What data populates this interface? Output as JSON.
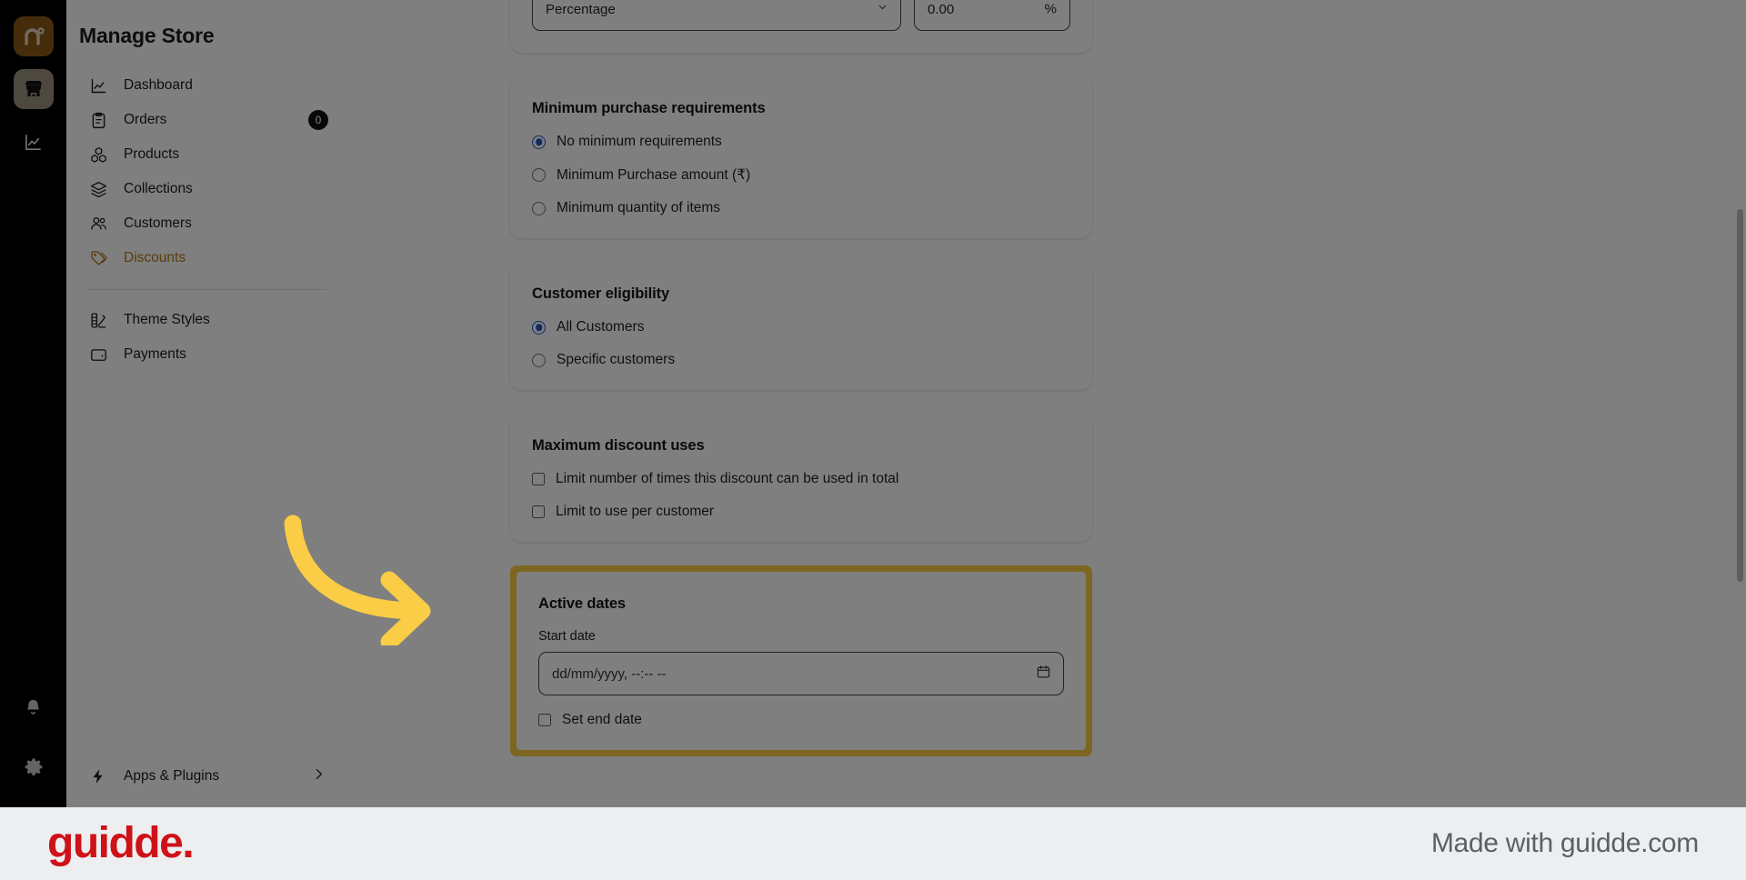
{
  "rail": {
    "logo_icon": "nuvemshop-n-logo-icon",
    "items": [
      {
        "name": "store-icon",
        "active": true
      },
      {
        "name": "analytics-icon",
        "active": false
      }
    ],
    "bottom": [
      {
        "name": "bell-icon"
      },
      {
        "name": "gear-icon"
      }
    ]
  },
  "sidebar": {
    "title": "Manage Store",
    "items": [
      {
        "label": "Dashboard",
        "icon": "chart-line-icon",
        "active": false,
        "badge": null
      },
      {
        "label": "Orders",
        "icon": "clipboard-icon",
        "active": false,
        "badge": "0"
      },
      {
        "label": "Products",
        "icon": "boxes-icon",
        "active": false,
        "badge": null
      },
      {
        "label": "Collections",
        "icon": "layers-icon",
        "active": false,
        "badge": null
      },
      {
        "label": "Customers",
        "icon": "users-icon",
        "active": false,
        "badge": null
      },
      {
        "label": "Discounts",
        "icon": "tags-icon",
        "active": true,
        "badge": null
      }
    ],
    "items2": [
      {
        "label": "Theme Styles",
        "icon": "palette-icon",
        "active": false
      },
      {
        "label": "Payments",
        "icon": "wallet-icon",
        "active": false
      }
    ],
    "apps": {
      "label": "Apps & Plugins",
      "icon": "bolt-icon",
      "chevron": "chevron-right-icon"
    }
  },
  "main": {
    "discount_value_card": {
      "type_value": "Percentage",
      "amount_value": "0.00",
      "amount_suffix": "%"
    },
    "minimum_purchase": {
      "title": "Minimum purchase requirements",
      "options": [
        {
          "label": "No minimum requirements",
          "checked": true
        },
        {
          "label": "Minimum Purchase amount (₹)",
          "checked": false
        },
        {
          "label": "Minimum quantity of items",
          "checked": false
        }
      ]
    },
    "customer_eligibility": {
      "title": "Customer eligibility",
      "options": [
        {
          "label": "All Customers",
          "checked": true
        },
        {
          "label": "Specific customers",
          "checked": false
        }
      ]
    },
    "maximum_uses": {
      "title": "Maximum discount uses",
      "options": [
        {
          "label": "Limit number of times this discount can be used in total",
          "checked": false
        },
        {
          "label": "Limit to use per customer",
          "checked": false
        }
      ]
    },
    "active_dates": {
      "title": "Active dates",
      "start_date_label": "Start date",
      "start_date_placeholder": "dd/mm/yyyy, --:-- --",
      "calendar_icon": "calendar-icon",
      "end_date_checkbox_label": "Set end date",
      "highlight_color": "#fbcc45"
    }
  },
  "annotation": {
    "arrow_icon": "curved-arrow-right-icon",
    "arrow_color": "#fbcc45"
  },
  "footer": {
    "logo_text": "guidde.",
    "logo_color": "#cf1118",
    "made_with": "Made with guidde.com"
  }
}
